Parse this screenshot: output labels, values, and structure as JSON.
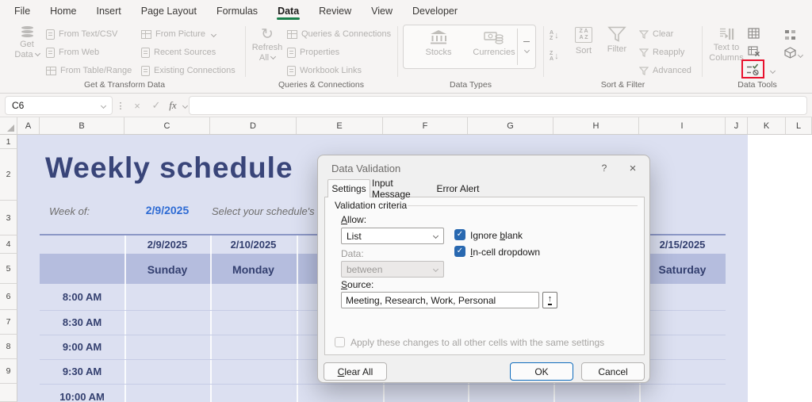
{
  "menu": {
    "items": [
      "File",
      "Home",
      "Insert",
      "Page Layout",
      "Formulas",
      "Data",
      "Review",
      "View",
      "Developer"
    ],
    "active": "Data"
  },
  "ribbon": {
    "g1": {
      "label": "Get & Transform Data",
      "big1": "Get",
      "big2": "Data",
      "c1": [
        "From Text/CSV",
        "From Web",
        "From Table/Range"
      ],
      "c2": [
        "From Picture",
        "Recent Sources",
        "Existing Connections"
      ]
    },
    "g2": {
      "label": "Queries & Connections",
      "big1": "Refresh",
      "big2": "All",
      "items": [
        "Queries & Connections",
        "Properties",
        "Workbook Links"
      ]
    },
    "g3": {
      "label": "Data Types",
      "items": [
        "Stocks",
        "Currencies"
      ]
    },
    "g4": {
      "label": "Sort & Filter",
      "sort": "Sort",
      "filter": "Filter",
      "items": [
        "Clear",
        "Reapply",
        "Advanced"
      ]
    },
    "g5": {
      "label": "Data Tools",
      "big1": "Text to",
      "big2": "Columns"
    }
  },
  "formula_bar": {
    "cell_ref": "C6",
    "fx": "fx",
    "value": ""
  },
  "sheet": {
    "columns": [
      "A",
      "B",
      "C",
      "D",
      "E",
      "F",
      "G",
      "H",
      "I",
      "J",
      "K",
      "L"
    ],
    "rows": [
      "1",
      "2",
      "3",
      "4",
      "5",
      "6",
      "7",
      "8",
      "9"
    ],
    "title": "Weekly schedule",
    "week_of": "Week of:",
    "week_value": "2/9/2025",
    "note": "Select your schedule's st",
    "date_c": "2/9/2025",
    "date_d": "2/10/2025",
    "date_i": "2/15/2025",
    "day_c": "Sunday",
    "day_d": "Monday",
    "day_i": "Saturday",
    "times": [
      "8:00 AM",
      "8:30 AM",
      "9:00 AM",
      "9:30 AM",
      "10:00 AM"
    ]
  },
  "dialog": {
    "title": "Data Validation",
    "help": "?",
    "close": "×",
    "tabs": [
      "Settings",
      "Input Message",
      "Error Alert"
    ],
    "section": "Validation criteria",
    "allow_key": "A",
    "allow_rest": "llow:",
    "allow_value": "List",
    "ignore_pre": "Ignore ",
    "ignore_key": "b",
    "ignore_rest": "lank",
    "incell_key": "I",
    "incell_rest": "n-cell dropdown",
    "data_label": "Data:",
    "data_value": "between",
    "source_key": "S",
    "source_rest": "ource:",
    "source_value": "Meeting, Research, Work, Personal",
    "apply": "Apply these changes to all other cells with the same settings",
    "clear_key": "C",
    "clear_rest": "lear All",
    "ok": "OK",
    "cancel": "Cancel"
  },
  "colors": {
    "tab_accent": "#1a7f4b",
    "checkbox_blue": "#2868b0",
    "ok_border": "#0f6cbd",
    "highlight_red": "#e8112d",
    "title_navy": "#394579",
    "week_value_blue": "#2e6bd4",
    "sheet_lavender": "#dce0f1",
    "band": "#b5bdde"
  }
}
